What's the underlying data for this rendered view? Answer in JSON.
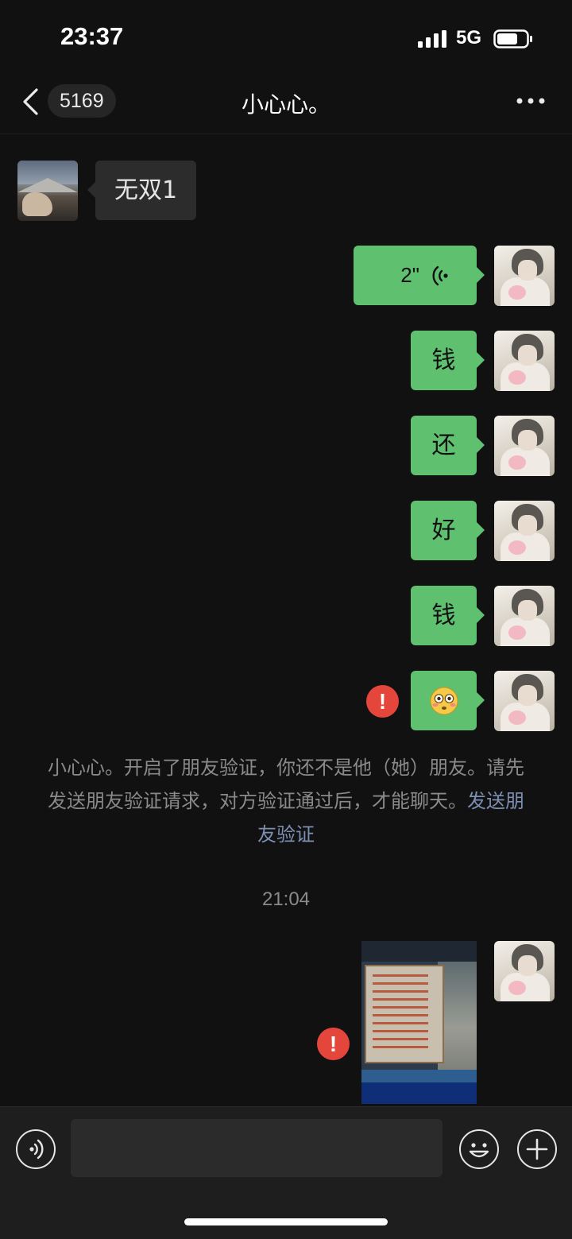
{
  "status_bar": {
    "time": "23:37",
    "network": "5G",
    "icons": [
      "signal-icon",
      "battery-icon"
    ]
  },
  "nav": {
    "back_icon": "chevron-left-icon",
    "unread_count": "5169",
    "title": "小心心。",
    "more_icon": "more-dots-icon"
  },
  "messages": [
    {
      "sender": "peer",
      "type": "text",
      "text": "无双1"
    },
    {
      "sender": "self",
      "type": "voice",
      "duration": "2\""
    },
    {
      "sender": "self",
      "type": "text",
      "text": "钱"
    },
    {
      "sender": "self",
      "type": "text",
      "text": "还"
    },
    {
      "sender": "self",
      "type": "text",
      "text": "好"
    },
    {
      "sender": "self",
      "type": "text",
      "text": "钱"
    },
    {
      "sender": "self",
      "type": "emoji",
      "emoji": "flushed-face-icon",
      "failed": true
    },
    {
      "sender": "self",
      "type": "image",
      "failed": true
    }
  ],
  "system_notice": {
    "text": "小心心。开启了朋友验证，你还不是他（她）朋友。请先发送朋友验证请求，对方验证通过后，才能聊天。",
    "link": "发送朋友验证"
  },
  "timestamp": "21:04",
  "error_badge": "!",
  "input_bar": {
    "placeholder": "",
    "icons": [
      "voice-input-icon",
      "emoji-icon",
      "plus-icon"
    ]
  },
  "colors": {
    "background": "#111111",
    "self_bubble": "#5fc16f",
    "peer_bubble": "#2c2c2c",
    "error": "#e4463c",
    "link": "#7d90b4"
  }
}
